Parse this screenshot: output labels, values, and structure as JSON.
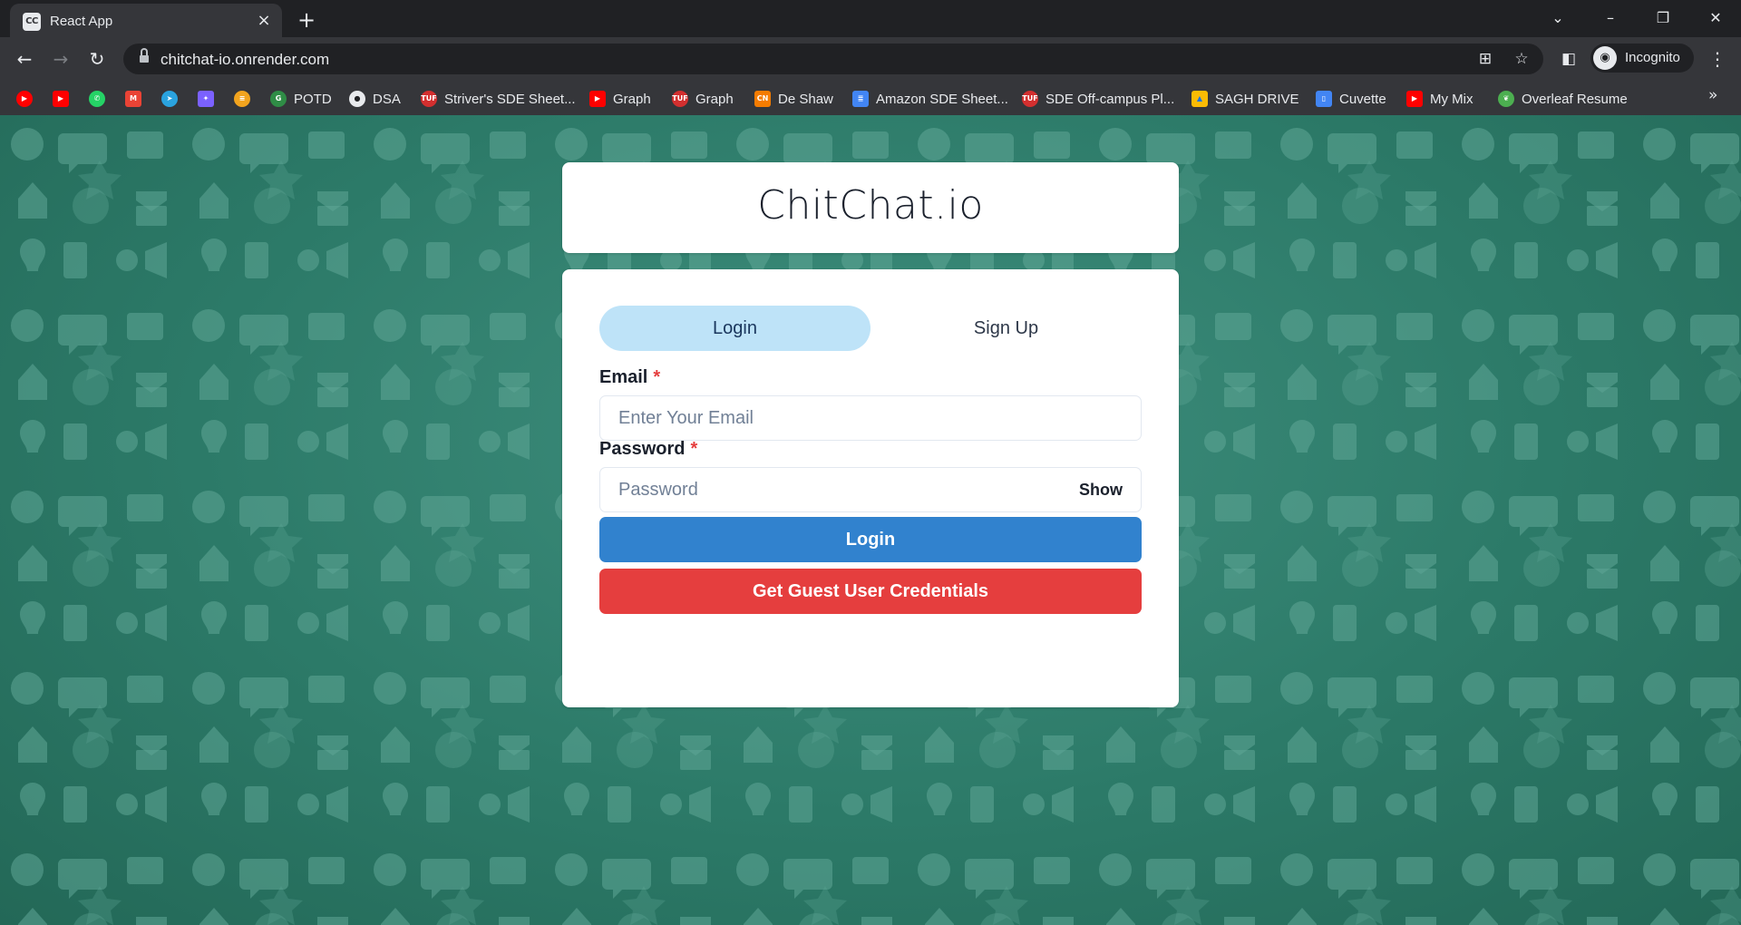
{
  "browser": {
    "tab_title": "React App",
    "tab_favicon_text": "CC",
    "url": "chitchat-io.onrender.com",
    "profile_label": "Incognito"
  },
  "bookmarks": [
    {
      "label": "",
      "icon": "youtube-music-icon",
      "color": "#ff0000"
    },
    {
      "label": "",
      "icon": "youtube-icon",
      "color": "#ff0000"
    },
    {
      "label": "",
      "icon": "whatsapp-icon",
      "color": "#25d366"
    },
    {
      "label": "",
      "icon": "gmail-icon",
      "color": "#ea4335"
    },
    {
      "label": "",
      "icon": "telegram-icon",
      "color": "#2aa3df"
    },
    {
      "label": "",
      "icon": "app-icon",
      "color": "#7b61ff"
    },
    {
      "label": "",
      "icon": "code-icon",
      "color": "#f2a41e"
    },
    {
      "label": "POTD",
      "icon": "gfg-icon",
      "color": "#2f8d46"
    },
    {
      "label": "DSA",
      "icon": "github-icon",
      "color": "#e8eaed"
    },
    {
      "label": "Striver's SDE Sheet...",
      "icon": "tuf-icon",
      "color": "#d32f2f"
    },
    {
      "label": "Graph",
      "icon": "youtube-icon",
      "color": "#ff0000"
    },
    {
      "label": "Graph",
      "icon": "tuf-icon",
      "color": "#d32f2f"
    },
    {
      "label": "De Shaw",
      "icon": "codingninjas-icon",
      "color": "#f57c00"
    },
    {
      "label": "Amazon SDE Sheet...",
      "icon": "docs-icon",
      "color": "#4285f4"
    },
    {
      "label": "SDE Off-campus Pl...",
      "icon": "tuf-icon",
      "color": "#d32f2f"
    },
    {
      "label": "SAGH DRIVE",
      "icon": "drive-icon",
      "color": "#fbbc04"
    },
    {
      "label": "Cuvette",
      "icon": "cuvette-icon",
      "color": "#4285f4"
    },
    {
      "label": "My Mix",
      "icon": "youtube-icon",
      "color": "#ff0000"
    },
    {
      "label": "Overleaf Resume",
      "icon": "overleaf-icon",
      "color": "#4caf50"
    }
  ],
  "app": {
    "title": "ChitChat.io",
    "tabs": [
      {
        "label": "Login",
        "active": true
      },
      {
        "label": "Sign Up",
        "active": false
      }
    ],
    "email": {
      "label": "Email",
      "required_mark": "*",
      "placeholder": "Enter Your Email",
      "value": ""
    },
    "password": {
      "label": "Password",
      "required_mark": "*",
      "placeholder": "Password",
      "value": "",
      "toggle_label": "Show"
    },
    "login_button": "Login",
    "guest_button": "Get Guest User Credentials"
  },
  "colors": {
    "background": "#2e7d6c",
    "tab_active": "#bee3f8",
    "login_button": "#3182ce",
    "guest_button": "#e53e3e",
    "required": "#e53e3e"
  }
}
